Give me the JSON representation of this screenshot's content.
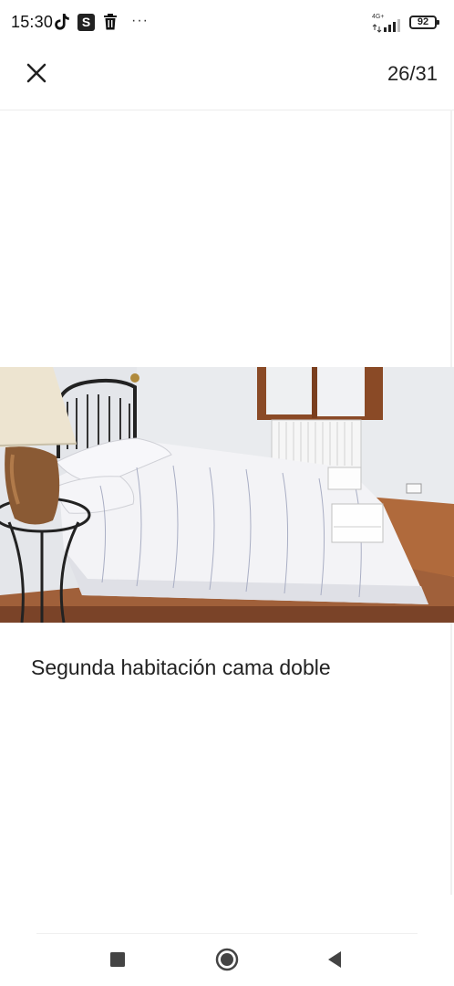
{
  "status_bar": {
    "time": "15:30",
    "network": "4G+",
    "battery": "92",
    "more": "···",
    "s_app": "S",
    "icons": [
      "tiktok-icon",
      "s-app-icon",
      "trash-icon",
      "more-icon",
      "signal-icon",
      "battery-icon"
    ]
  },
  "toolbar": {
    "close_icon": "close-icon",
    "counter": "26/31"
  },
  "photo": {
    "subject": "bedroom-photo"
  },
  "caption": "Segunda habitación cama doble",
  "nav": {
    "icons": [
      "recents-square-icon",
      "home-circle-icon",
      "back-triangle-icon"
    ]
  },
  "colors": {
    "text": "#222222",
    "background": "#ffffff",
    "nav_icons": "#444444"
  }
}
